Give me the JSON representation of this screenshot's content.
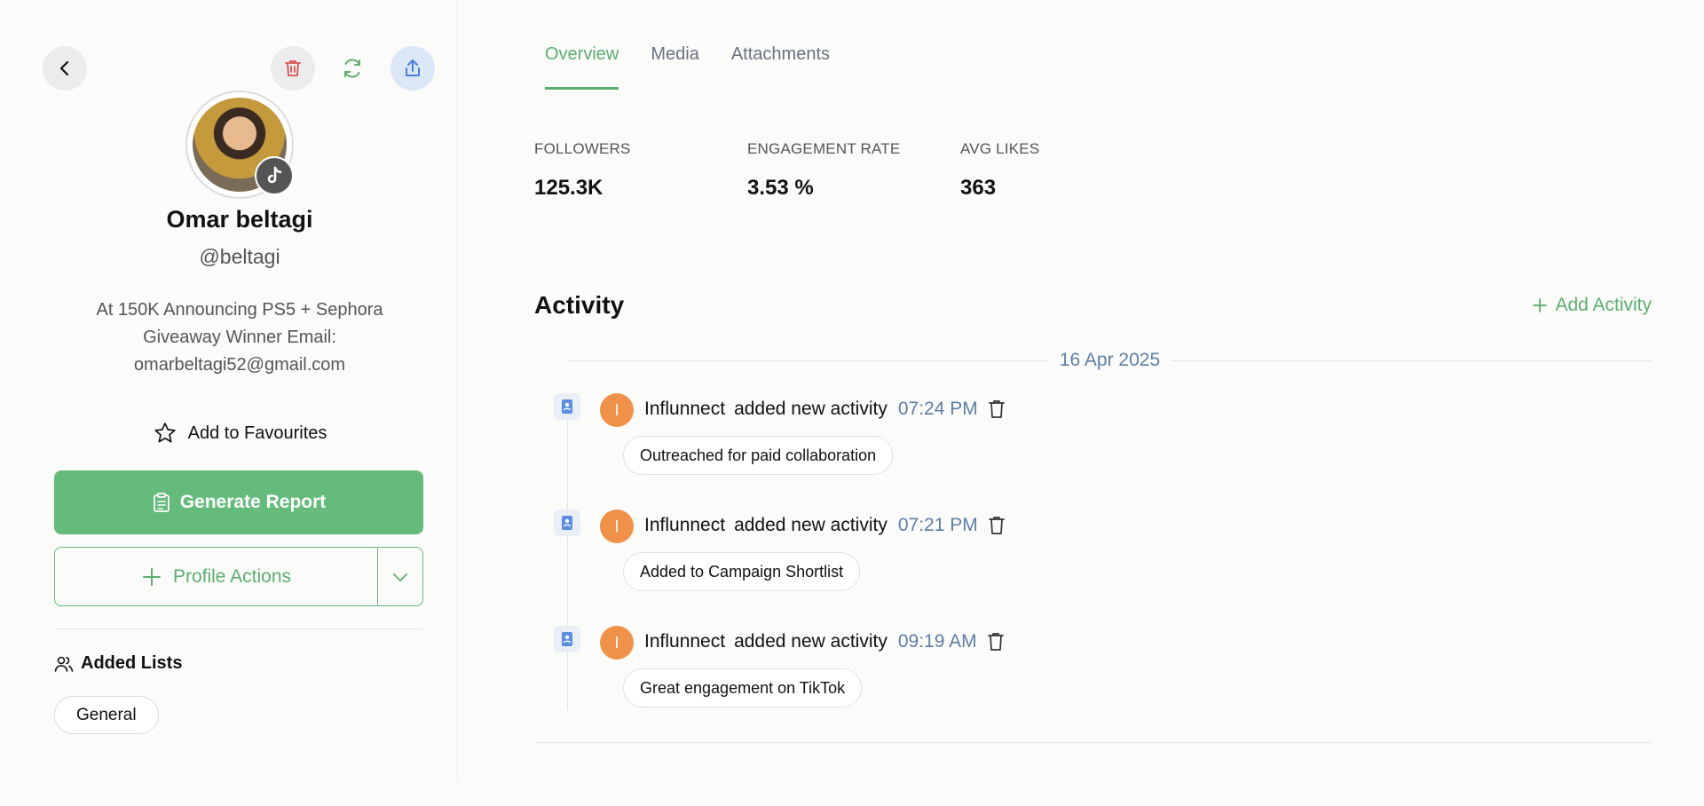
{
  "profile": {
    "name": "Omar beltagi",
    "handle": "@beltagi",
    "bio_line1": "At 150K Announcing PS5 + Sephora",
    "bio_line2": "Giveaway Winner Email:",
    "bio_line3": "omarbeltagi52@gmail.com",
    "platform_icon": "tiktok-icon"
  },
  "actions": {
    "favourite_label": "Add to Favourites",
    "generate_label": "Generate Report",
    "profile_actions_label": "Profile Actions"
  },
  "lists": {
    "title": "Added Lists",
    "items": [
      "General"
    ]
  },
  "tabs": [
    {
      "label": "Overview",
      "active": true
    },
    {
      "label": "Media",
      "active": false
    },
    {
      "label": "Attachments",
      "active": false
    }
  ],
  "stats": [
    {
      "label": "FOLLOWERS",
      "value": "125.3K"
    },
    {
      "label": "ENGAGEMENT RATE",
      "value": "3.53 %"
    },
    {
      "label": "AVG LIKES",
      "value": "363"
    }
  ],
  "activity": {
    "title": "Activity",
    "add_label": "Add Activity",
    "date": "16 Apr 2025",
    "items": [
      {
        "avatar_letter": "I",
        "user": "Influnnect",
        "action": "added new activity",
        "time": "07:24 PM",
        "note": "Outreached for paid collaboration"
      },
      {
        "avatar_letter": "I",
        "user": "Influnnect",
        "action": "added new activity",
        "time": "07:21 PM",
        "note": "Added to Campaign Shortlist"
      },
      {
        "avatar_letter": "I",
        "user": "Influnnect",
        "action": "added new activity",
        "time": "09:19 AM",
        "note": "Great engagement on TikTok"
      }
    ]
  },
  "colors": {
    "accent_green": "#65bb7b",
    "date_blue": "#5c7fa6",
    "avatar_orange": "#f0914a",
    "delete_red": "#d9534f"
  }
}
